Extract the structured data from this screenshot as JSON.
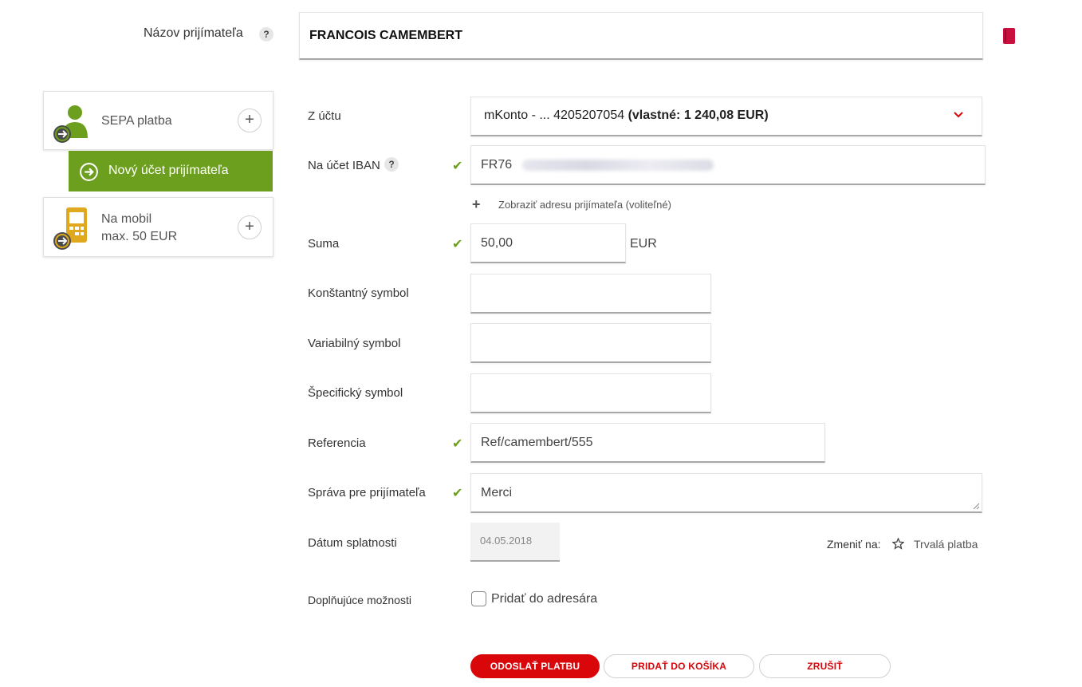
{
  "recipient": {
    "label": "Názov prijímateľa",
    "help": "?",
    "value": "FRANCOIS CAMEMBERT"
  },
  "sidebar": {
    "sepa_label": "SEPA platba",
    "new_account_label": "Nový účet prijímateľa",
    "mobile_label_line1": "Na mobil",
    "mobile_label_line2": "max. 50 EUR",
    "plus": "+"
  },
  "form": {
    "from_account": {
      "label": "Z účtu",
      "value_prefix": "mKonto - ... 4205207054 ",
      "value_bold": "(vlastné: 1 240,08 EUR)"
    },
    "iban": {
      "label": "Na účet IBAN",
      "help": "?",
      "value": "FR76"
    },
    "show_address": {
      "plus": "+",
      "label": "Zobraziť adresu prijímateľa (voliteľné)"
    },
    "amount": {
      "label": "Suma",
      "value": "50,00",
      "currency": "EUR"
    },
    "constant_symbol": {
      "label": "Konštantný symbol",
      "value": ""
    },
    "variable_symbol": {
      "label": "Variabilný symbol",
      "value": ""
    },
    "specific_symbol": {
      "label": "Špecifický symbol",
      "value": ""
    },
    "reference": {
      "label": "Referencia",
      "value": "Ref/camembert/555"
    },
    "message": {
      "label": "Správa pre prijímateľa",
      "value": "Merci"
    },
    "due_date": {
      "label": "Dátum splatnosti",
      "value": "04.05.2018",
      "change_to_label": "Zmeniť na:",
      "standing_order_label": "Trvalá platba"
    },
    "extra_options": {
      "label": "Doplňujúce možnosti",
      "add_to_address_book": "Pridať do adresára",
      "checked": false
    },
    "check_mark": "✔"
  },
  "actions": {
    "send": "ODOSLAŤ PLATBU",
    "add_to_cart": "PRIDAŤ DO KOŠÍKA",
    "cancel": "ZRUŠIŤ"
  },
  "colors": {
    "accent_green": "#6d9f1e",
    "accent_red": "#d9060a",
    "mobile_icon": "#e0a81d"
  }
}
